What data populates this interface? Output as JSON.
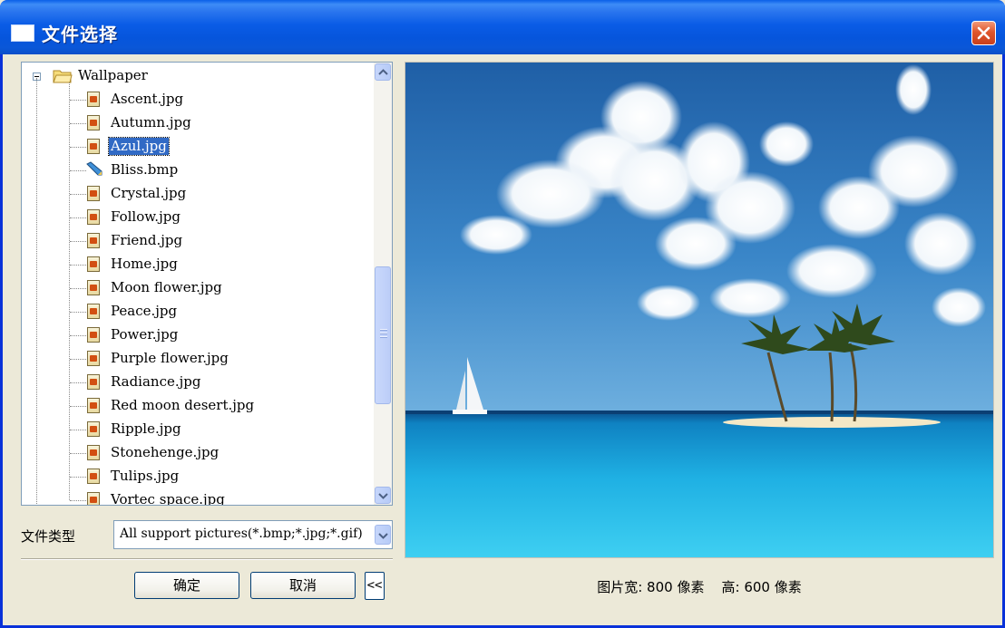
{
  "window": {
    "title": "文件选择"
  },
  "tree": {
    "folder": "Wallpaper",
    "files": [
      {
        "name": "Ascent.jpg",
        "icon": "jpg-file-icon"
      },
      {
        "name": "Autumn.jpg",
        "icon": "jpg-file-icon"
      },
      {
        "name": "Azul.jpg",
        "icon": "jpg-file-icon",
        "selected": true
      },
      {
        "name": "Bliss.bmp",
        "icon": "bmp-file-icon"
      },
      {
        "name": "Crystal.jpg",
        "icon": "jpg-file-icon"
      },
      {
        "name": "Follow.jpg",
        "icon": "jpg-file-icon"
      },
      {
        "name": "Friend.jpg",
        "icon": "jpg-file-icon"
      },
      {
        "name": "Home.jpg",
        "icon": "jpg-file-icon"
      },
      {
        "name": "Moon flower.jpg",
        "icon": "jpg-file-icon"
      },
      {
        "name": "Peace.jpg",
        "icon": "jpg-file-icon"
      },
      {
        "name": "Power.jpg",
        "icon": "jpg-file-icon"
      },
      {
        "name": "Purple flower.jpg",
        "icon": "jpg-file-icon"
      },
      {
        "name": "Radiance.jpg",
        "icon": "jpg-file-icon"
      },
      {
        "name": "Red moon desert.jpg",
        "icon": "jpg-file-icon"
      },
      {
        "name": "Ripple.jpg",
        "icon": "jpg-file-icon"
      },
      {
        "name": "Stonehenge.jpg",
        "icon": "jpg-file-icon"
      },
      {
        "name": "Tulips.jpg",
        "icon": "jpg-file-icon"
      },
      {
        "name": "Vortec space.jpg",
        "icon": "jpg-file-icon"
      }
    ]
  },
  "filter": {
    "label": "文件类型",
    "value": "All support pictures(*.bmp;*.jpg;*.gif)"
  },
  "buttons": {
    "ok": "确定",
    "cancel": "取消",
    "toggle": "<<"
  },
  "preview": {
    "dimensions_text": "图片宽: 800 像素    高: 600 像素"
  },
  "colors": {
    "title_bar": "#0a5ce6",
    "selection": "#316ac5",
    "close_button": "#e0562c"
  }
}
